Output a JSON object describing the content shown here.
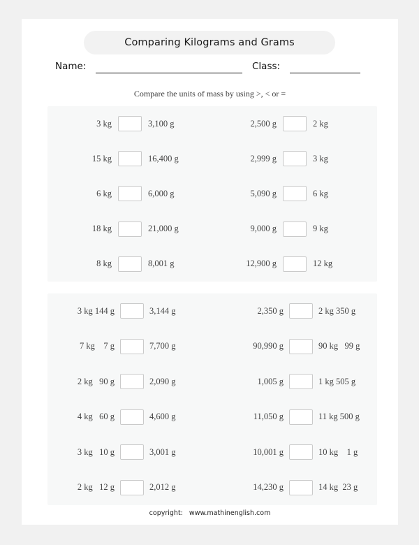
{
  "worksheet": {
    "title": "Comparing Kilograms and Grams",
    "name_label": "Name:",
    "class_label": "Class:",
    "instruction": "Compare the units of mass by using >, < or =",
    "footer": "copyright:   www.mathinenglish.com",
    "colors": {
      "page_background": "#ffffff",
      "outer_background": "#f1f1f1",
      "panel_background": "#f7f8f8",
      "title_pill_background": "#f2f2f2",
      "answer_box_border": "#cacaca",
      "operand_text": "#444444"
    }
  },
  "sections": [
    {
      "id": "section-1",
      "rows": [
        {
          "left_a": "3 kg",
          "right_a": "3,100 g",
          "left_b": "2,500 g",
          "right_b": "2 kg"
        },
        {
          "left_a": "15 kg",
          "right_a": "16,400 g",
          "left_b": "2,999 g",
          "right_b": "3 kg"
        },
        {
          "left_a": "6 kg",
          "right_a": "6,000 g",
          "left_b": "5,090 g",
          "right_b": "6 kg"
        },
        {
          "left_a": "18 kg",
          "right_a": "21,000 g",
          "left_b": "9,000 g",
          "right_b": "9 kg"
        },
        {
          "left_a": "8 kg",
          "right_a": "8,001 g",
          "left_b": "12,900 g",
          "right_b": "12 kg"
        }
      ]
    },
    {
      "id": "section-2",
      "rows": [
        {
          "left_a": "3 kg 144 g",
          "right_a": "3,144 g",
          "left_b": "2,350 g",
          "right_b": "2 kg 350 g"
        },
        {
          "left_a": "7 kg    7 g",
          "right_a": "7,700 g",
          "left_b": "90,990 g",
          "right_b": "90 kg   99 g"
        },
        {
          "left_a": "2 kg   90 g",
          "right_a": "2,090 g",
          "left_b": "1,005 g",
          "right_b": "1 kg 505 g"
        },
        {
          "left_a": "4 kg   60 g",
          "right_a": "4,600 g",
          "left_b": "11,050 g",
          "right_b": "11 kg 500 g"
        },
        {
          "left_a": "3 kg   10 g",
          "right_a": "3,001 g",
          "left_b": "10,001 g",
          "right_b": "10 kg    1 g"
        },
        {
          "left_a": "2 kg   12 g",
          "right_a": "2,012 g",
          "left_b": "14,230 g",
          "right_b": "14 kg  23 g"
        }
      ]
    }
  ]
}
